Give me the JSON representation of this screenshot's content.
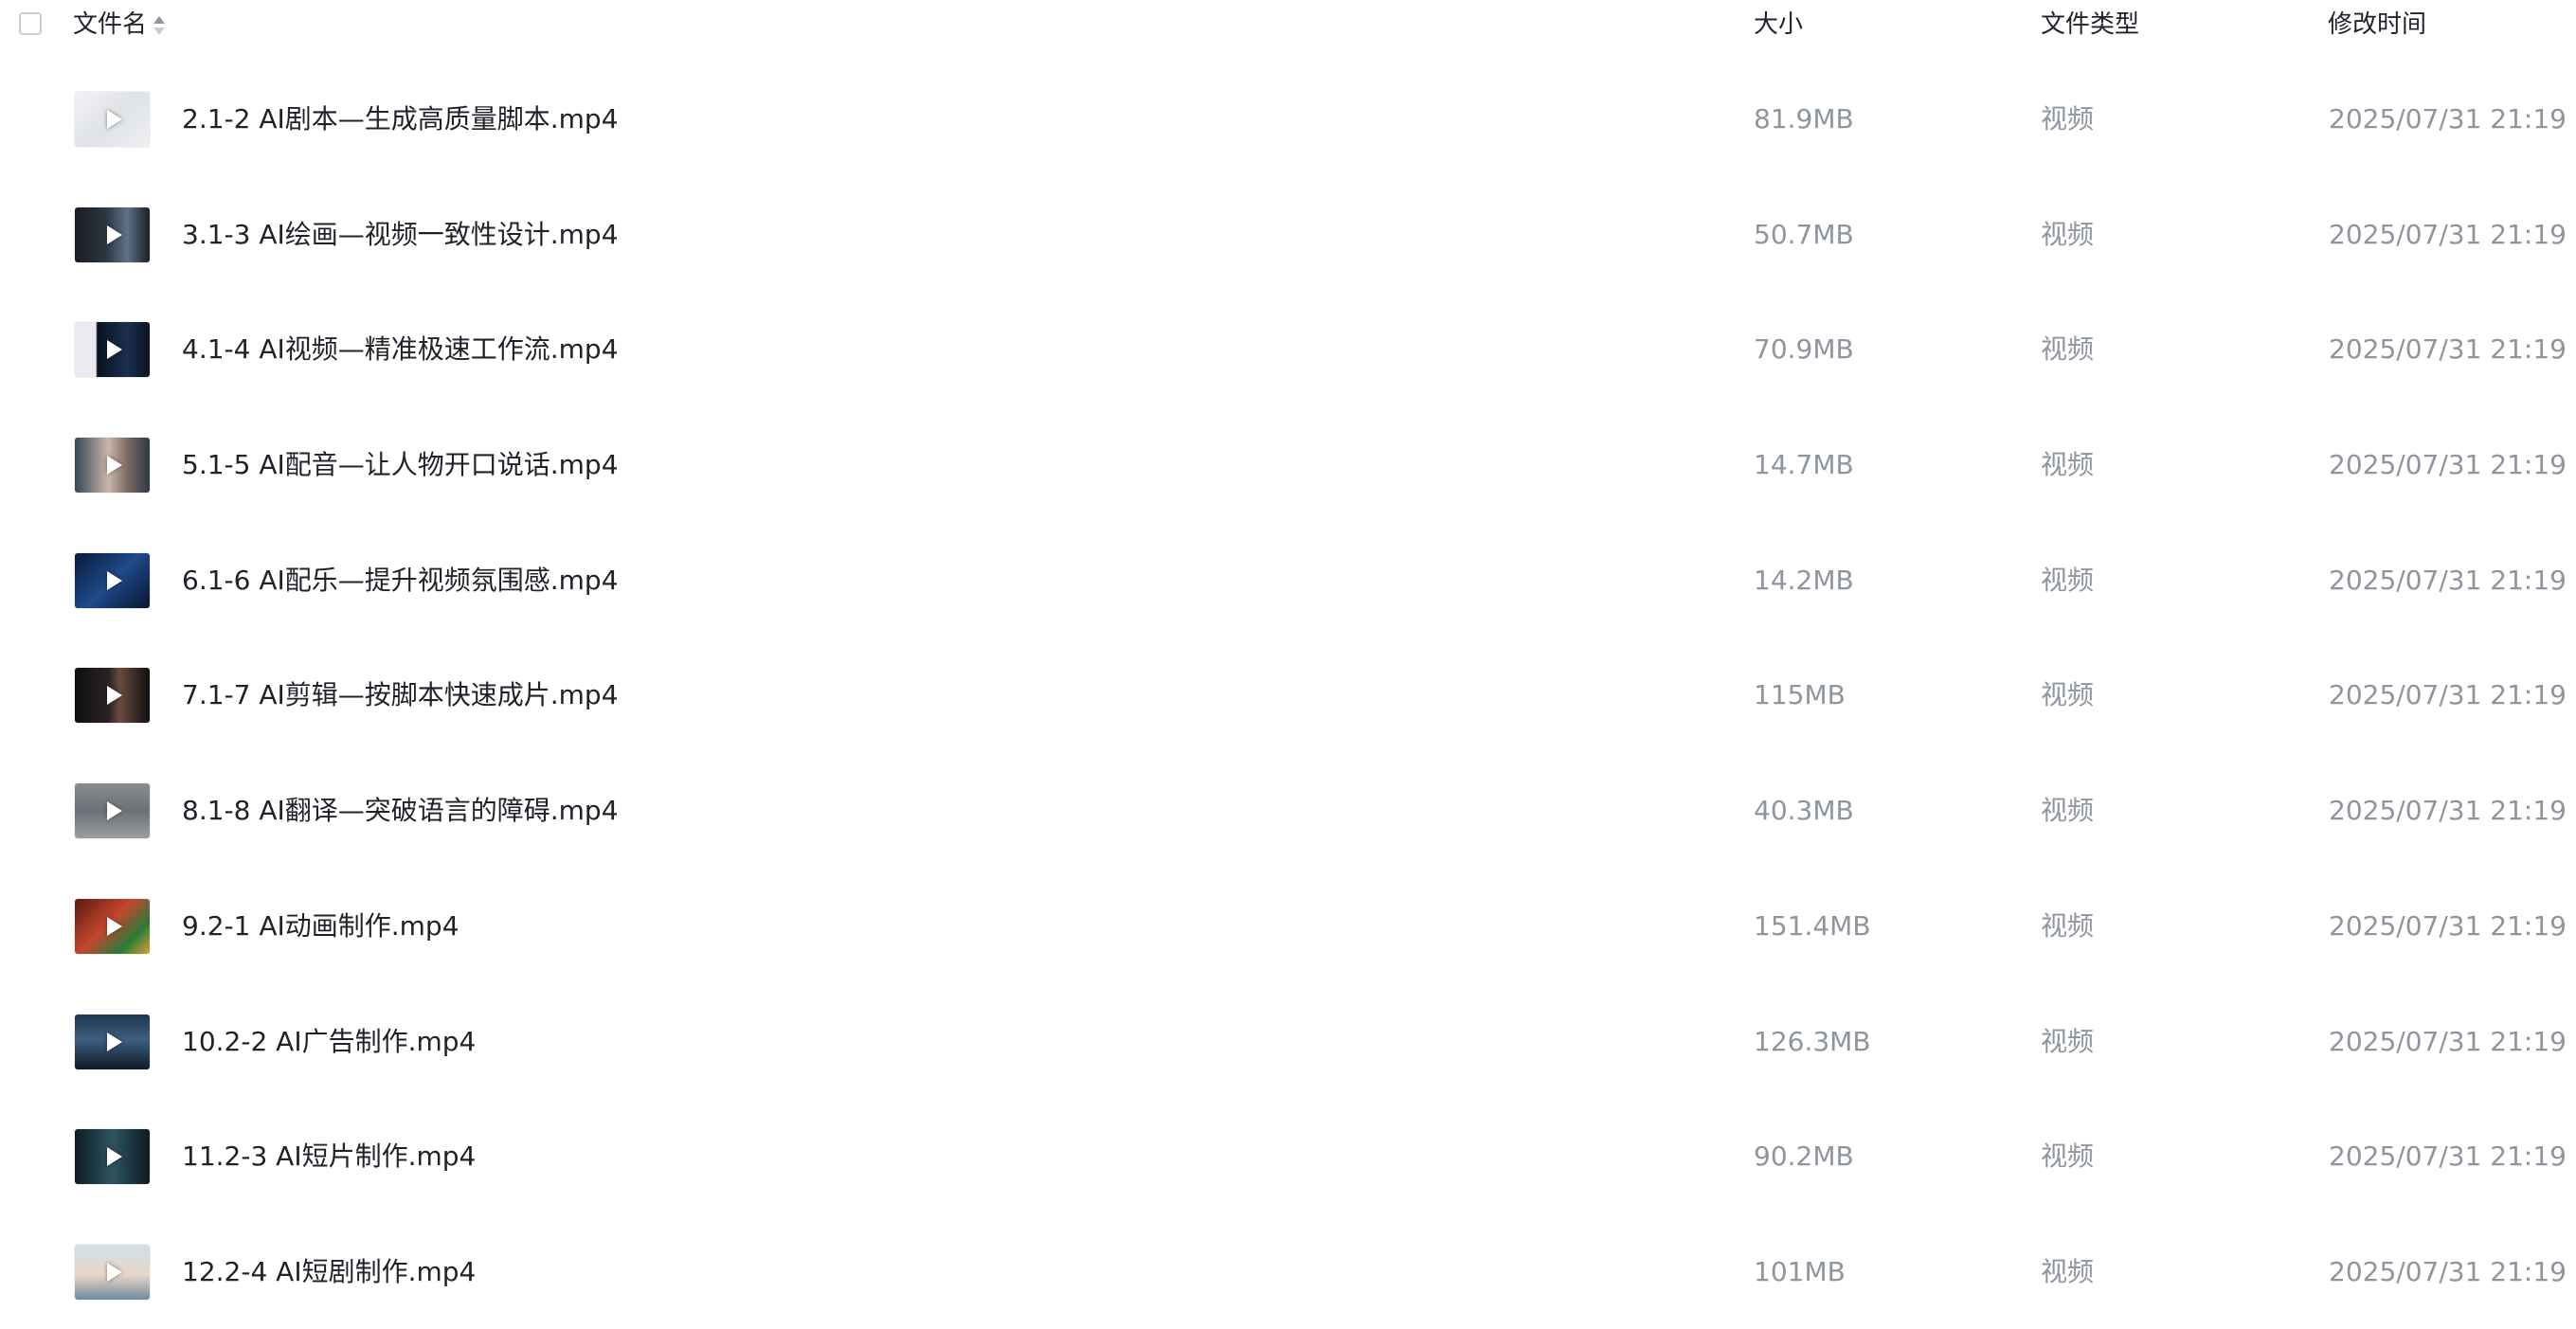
{
  "header": {
    "name_label": "文件名",
    "size_label": "大小",
    "type_label": "文件类型",
    "time_label": "修改时间"
  },
  "files": [
    {
      "name": "2.1-2 AI剧本—生成高质量脚本.mp4",
      "size": "81.9MB",
      "type": "视频",
      "modified": "2025/07/31 21:19"
    },
    {
      "name": "3.1-3 AI绘画—视频一致性设计.mp4",
      "size": "50.7MB",
      "type": "视频",
      "modified": "2025/07/31 21:19"
    },
    {
      "name": "4.1-4 AI视频—精准极速工作流.mp4",
      "size": "70.9MB",
      "type": "视频",
      "modified": "2025/07/31 21:19"
    },
    {
      "name": "5.1-5 AI配音—让人物开口说话.mp4",
      "size": "14.7MB",
      "type": "视频",
      "modified": "2025/07/31 21:19"
    },
    {
      "name": "6.1-6 AI配乐—提升视频氛围感.mp4",
      "size": "14.2MB",
      "type": "视频",
      "modified": "2025/07/31 21:19"
    },
    {
      "name": "7.1-7 AI剪辑—按脚本快速成片.mp4",
      "size": "115MB",
      "type": "视频",
      "modified": "2025/07/31 21:19"
    },
    {
      "name": "8.1-8 AI翻译—突破语言的障碍.mp4",
      "size": "40.3MB",
      "type": "视频",
      "modified": "2025/07/31 21:19"
    },
    {
      "name": "9.2-1 AI动画制作.mp4",
      "size": "151.4MB",
      "type": "视频",
      "modified": "2025/07/31 21:19"
    },
    {
      "name": "10.2-2 AI广告制作.mp4",
      "size": "126.3MB",
      "type": "视频",
      "modified": "2025/07/31 21:19"
    },
    {
      "name": "11.2-3 AI短片制作.mp4",
      "size": "90.2MB",
      "type": "视频",
      "modified": "2025/07/31 21:19"
    },
    {
      "name": "12.2-4 AI短剧制作.mp4",
      "size": "101MB",
      "type": "视频",
      "modified": "2025/07/31 21:19"
    }
  ]
}
